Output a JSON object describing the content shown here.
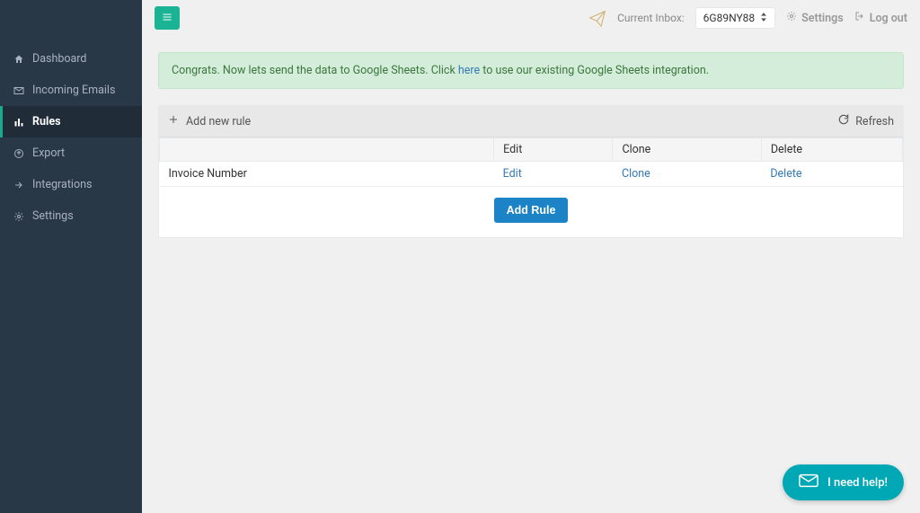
{
  "sidebar": {
    "items": [
      {
        "label": "Dashboard"
      },
      {
        "label": "Incoming Emails"
      },
      {
        "label": "Rules"
      },
      {
        "label": "Export"
      },
      {
        "label": "Integrations"
      },
      {
        "label": "Settings"
      }
    ]
  },
  "topbar": {
    "current_inbox_label": "Current Inbox:",
    "current_inbox_value": "6G89NY88",
    "settings_label": "Settings",
    "logout_label": "Log out"
  },
  "alert": {
    "text_before": "Congrats. Now lets send the data to Google Sheets. Click ",
    "link_text": "here",
    "text_after": " to use our existing Google Sheets integration."
  },
  "toolbar": {
    "add_new_rule_label": "Add new rule",
    "refresh_label": "Refresh"
  },
  "table": {
    "headers": {
      "name": "",
      "edit": "Edit",
      "clone": "Clone",
      "delete": "Delete"
    },
    "rows": [
      {
        "name": "Invoice Number",
        "edit": "Edit",
        "clone": "Clone",
        "delete": "Delete"
      }
    ]
  },
  "buttons": {
    "add_rule": "Add Rule"
  },
  "help_widget": {
    "label": "I need help!"
  }
}
